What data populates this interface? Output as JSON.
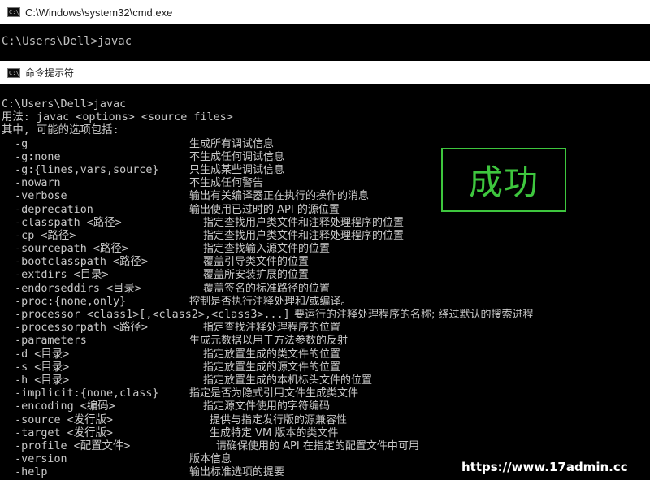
{
  "window_title": "C:\\Windows\\system32\\cmd.exe",
  "second_window_title": "命令提示符",
  "first_prompt": "C:\\Users\\Dell>javac",
  "console_header": [
    "C:\\Users\\Dell>javac",
    "用法: javac <options> <source files>",
    "其中, 可能的选项包括:"
  ],
  "options": [
    {
      "opt": "  -g",
      "desc": "生成所有调试信息",
      "col": 233
    },
    {
      "opt": "  -g:none",
      "desc": "不生成任何调试信息",
      "col": 233
    },
    {
      "opt": "  -g:{lines,vars,source}",
      "desc": "只生成某些调试信息",
      "col": 233
    },
    {
      "opt": "  -nowarn",
      "desc": "不生成任何警告",
      "col": 233
    },
    {
      "opt": "  -verbose",
      "desc": "输出有关编译器正在执行的操作的消息",
      "col": 233
    },
    {
      "opt": "  -deprecation",
      "desc": "输出使用已过时的 API 的源位置",
      "col": 233
    },
    {
      "opt": "  -classpath <路径>",
      "desc": "指定查找用户类文件和注释处理程序的位置",
      "col": 250
    },
    {
      "opt": "  -cp <路径>",
      "desc": "指定查找用户类文件和注释处理程序的位置",
      "col": 250
    },
    {
      "opt": "  -sourcepath <路径>",
      "desc": "指定查找输入源文件的位置",
      "col": 250
    },
    {
      "opt": "  -bootclasspath <路径>",
      "desc": "覆盖引导类文件的位置",
      "col": 250
    },
    {
      "opt": "  -extdirs <目录>",
      "desc": "覆盖所安装扩展的位置",
      "col": 250
    },
    {
      "opt": "  -endorseddirs <目录>",
      "desc": "覆盖签名的标准路径的位置",
      "col": 250
    },
    {
      "opt": "  -proc:{none,only}",
      "desc": "控制是否执行注释处理和/或编译。",
      "col": 233
    },
    {
      "opt": "  -processor <class1>[,<class2>,<class3>...]",
      "desc": "要运行的注释处理程序的名称; 绕过默认的搜索进程",
      "col": 362
    },
    {
      "opt": "  -processorpath <路径>",
      "desc": "指定查找注释处理程序的位置",
      "col": 250
    },
    {
      "opt": "  -parameters",
      "desc": "生成元数据以用于方法参数的反射",
      "col": 233
    },
    {
      "opt": "  -d <目录>",
      "desc": "指定放置生成的类文件的位置",
      "col": 250
    },
    {
      "opt": "  -s <目录>",
      "desc": "指定放置生成的源文件的位置",
      "col": 250
    },
    {
      "opt": "  -h <目录>",
      "desc": "指定放置生成的本机标头文件的位置",
      "col": 250
    },
    {
      "opt": "  -implicit:{none,class}",
      "desc": "指定是否为隐式引用文件生成类文件",
      "col": 233
    },
    {
      "opt": "  -encoding <编码>",
      "desc": "指定源文件使用的字符编码",
      "col": 250
    },
    {
      "opt": "  -source <发行版>",
      "desc": "提供与指定发行版的源兼容性",
      "col": 258
    },
    {
      "opt": "  -target <发行版>",
      "desc": "生成特定 VM 版本的类文件",
      "col": 258
    },
    {
      "opt": "  -profile <配置文件>",
      "desc": "请确保使用的 API 在指定的配置文件中可用",
      "col": 266
    },
    {
      "opt": "  -version",
      "desc": "版本信息",
      "col": 233
    },
    {
      "opt": "  -help",
      "desc": "输出标准选项的提要",
      "col": 233
    }
  ],
  "banner_text": "成功",
  "watermark": "https://www.17admin.cc",
  "colors": {
    "console_bg": "#000000",
    "console_text": "#c0c0c0",
    "success_green": "#3ec63e"
  },
  "icons": {
    "console_app": "cmd-icon"
  }
}
